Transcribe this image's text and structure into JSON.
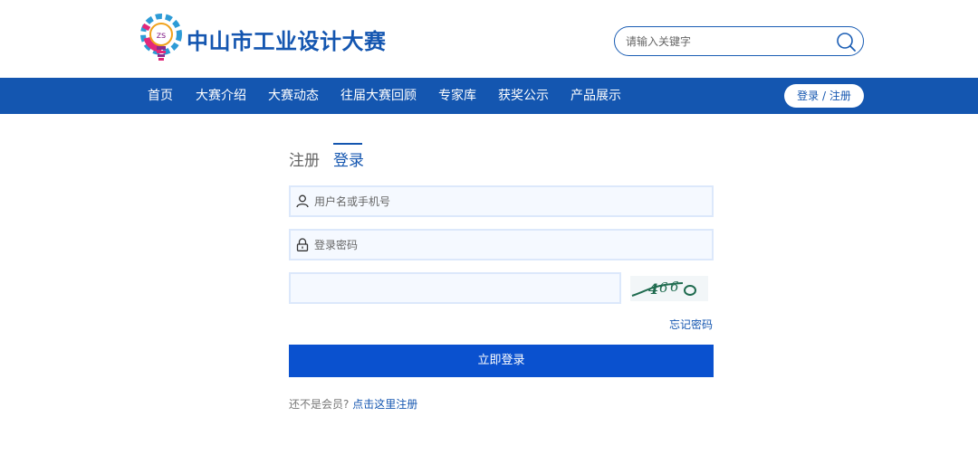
{
  "header": {
    "site_title": "中山市工业设计大赛",
    "logo_icon": "gear-lightbulb-logo"
  },
  "search": {
    "placeholder": "请输入关键字",
    "icon": "search-icon"
  },
  "nav": {
    "items": [
      {
        "label": "首页"
      },
      {
        "label": "大赛介绍"
      },
      {
        "label": "大赛动态"
      },
      {
        "label": "往届大赛回顾"
      },
      {
        "label": "专家库"
      },
      {
        "label": "获奖公示"
      },
      {
        "label": "产品展示"
      }
    ],
    "login_register": "登录 / 注册"
  },
  "form": {
    "tab_register": "注册",
    "tab_login": "登录",
    "active_tab": "登录",
    "username_placeholder": "用户名或手机号",
    "password_placeholder": "登录密码",
    "captcha_placeholder": "",
    "forgot_password": "忘记密码",
    "submit": "立即登录",
    "signup_prompt": "还不是会员?",
    "signup_link": "点击这里注册"
  },
  "colors": {
    "brand_blue": "#1456b0",
    "button_blue": "#0a51cf",
    "field_border": "#dce8fb",
    "field_bg": "#f5f9ff"
  }
}
